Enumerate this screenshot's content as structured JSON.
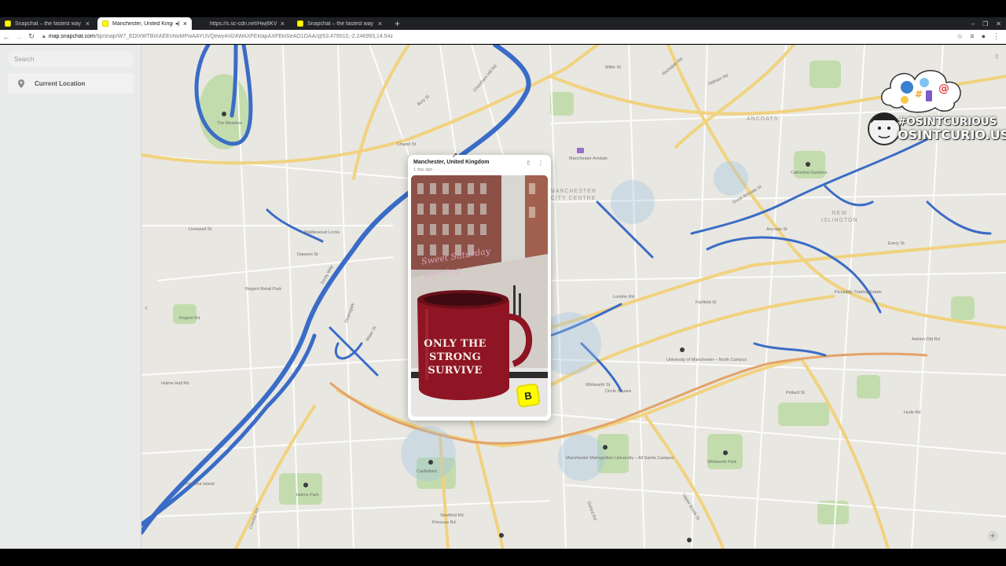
{
  "browser": {
    "tabs": [
      {
        "title": "Snapchat – the fastest way to",
        "icon": "snapchat-icon",
        "active": false
      },
      {
        "title": "Manchester, United Kingd",
        "icon": "snapchat-icon",
        "active": true
      },
      {
        "title": "https://s.sc-cdn.net/Hwj6KV",
        "icon": "blank",
        "active": false
      },
      {
        "title": "Snapchat – the fastest way to",
        "icon": "snapchat-icon",
        "active": false
      }
    ],
    "new_tab_glyph": "+",
    "url_host": "map.snapchat.com",
    "url_path": "/ttp/snap/W7_EDlXWTBiXAEEnNoMPwAAYUVQewy4nI24WAXFEkIapAXFEkiSeAO1OAA/@53.476510,-2.246993,14.54z"
  },
  "sidebar": {
    "search_placeholder": "Search",
    "current_location_label": "Current Location"
  },
  "snap_card": {
    "location": "Manchester, United Kingdom",
    "time_ago": "1 day ago",
    "caption": "Sweet Saturday morning",
    "mug_text": "ONLY THE STRONG SURVIVE",
    "sticker": "B"
  },
  "branding": {
    "hashtag": "#OSINTCURIOUS",
    "site": "OSINTCURIO.US"
  },
  "map": {
    "district_labels": [
      "MANCHESTER CITY CENTRE",
      "ANCOATS",
      "NEW ISLINGTON"
    ],
    "places": [
      "The Meadow",
      "Manchester Arndale",
      "University of Manchester – North Campus",
      "Manchester Metropolitan University – All Saints Campus",
      "Cathedral Gardens",
      "Regent Retail Park",
      "Middlewood Locks",
      "Pomona Island",
      "Hulme Park",
      "Whitworth Park",
      "Circle Square",
      "Castlefield",
      "Piccadilly Trading Estate"
    ],
    "streets": [
      "Chapel St",
      "Liverpool St",
      "Trinity Way",
      "Deansgate",
      "Oxford Rd",
      "Princess Rd",
      "Great Ancoats St",
      "Rochdale Rd",
      "Oldham Rd",
      "Ashton Old Rd",
      "Hyde Rd",
      "Stretford Rd",
      "Chester Rd",
      "Upper Brook St",
      "Hulme Hall Rd",
      "Regent Rd",
      "Water St",
      "Whitworth St",
      "London Rd",
      "Fairfield St",
      "Cheetham Hill Rd",
      "Bury St",
      "Dawson St",
      "Miller St",
      "Pollard St",
      "Every St",
      "Ancoats St"
    ]
  },
  "colors": {
    "map_bg": "#e9e7e1",
    "water": "#3a6cc7",
    "park": "#b7d7a0",
    "major_road": "#f1d27f",
    "snap_yellow": "#fffc00"
  }
}
